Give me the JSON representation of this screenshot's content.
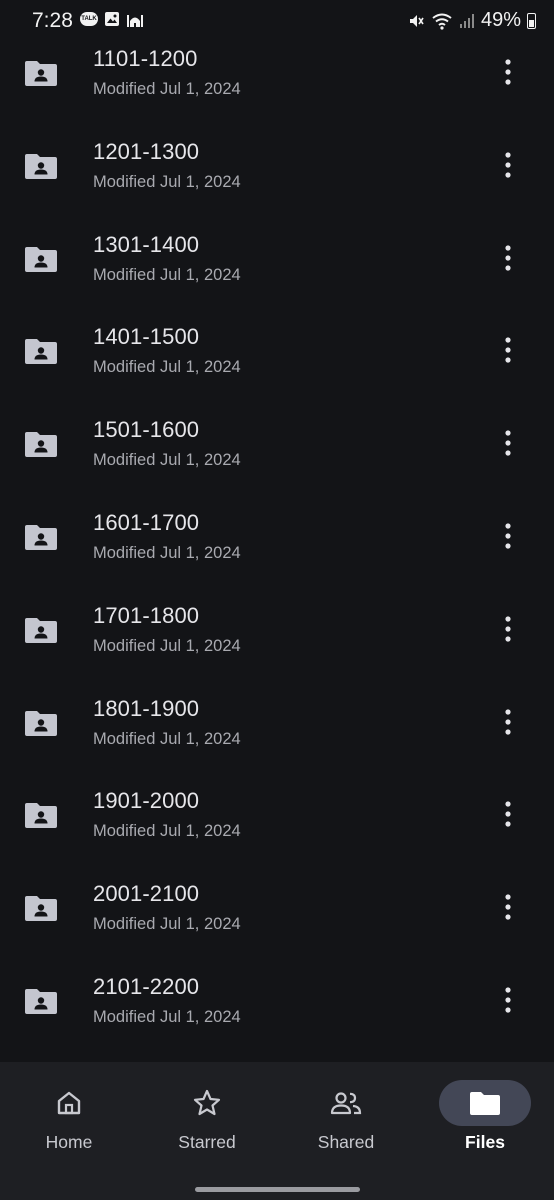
{
  "status_bar": {
    "time": "7:28",
    "talk_badge": "TALK",
    "battery": "49%"
  },
  "files": [
    {
      "name": "1101-1200",
      "modified": "Modified Jul 1, 2024"
    },
    {
      "name": "1201-1300",
      "modified": "Modified Jul 1, 2024"
    },
    {
      "name": "1301-1400",
      "modified": "Modified Jul 1, 2024"
    },
    {
      "name": "1401-1500",
      "modified": "Modified Jul 1, 2024"
    },
    {
      "name": "1501-1600",
      "modified": "Modified Jul 1, 2024"
    },
    {
      "name": "1601-1700",
      "modified": "Modified Jul 1, 2024"
    },
    {
      "name": "1701-1800",
      "modified": "Modified Jul 1, 2024"
    },
    {
      "name": "1801-1900",
      "modified": "Modified Jul 1, 2024"
    },
    {
      "name": "1901-2000",
      "modified": "Modified Jul 1, 2024"
    },
    {
      "name": "2001-2100",
      "modified": "Modified Jul 1, 2024"
    },
    {
      "name": "2101-2200",
      "modified": "Modified Jul 1, 2024"
    }
  ],
  "bottom_nav": {
    "items": [
      {
        "label": "Home",
        "icon": "home-icon",
        "active": false
      },
      {
        "label": "Starred",
        "icon": "star-icon",
        "active": false
      },
      {
        "label": "Shared",
        "icon": "people-icon",
        "active": false
      },
      {
        "label": "Files",
        "icon": "folder-icon",
        "active": true
      }
    ]
  },
  "colors": {
    "background": "#131417",
    "nav_background": "#1e1f23",
    "active_pill": "#434756",
    "primary_text": "#e6e6ea",
    "secondary_text": "#a9aab0"
  }
}
